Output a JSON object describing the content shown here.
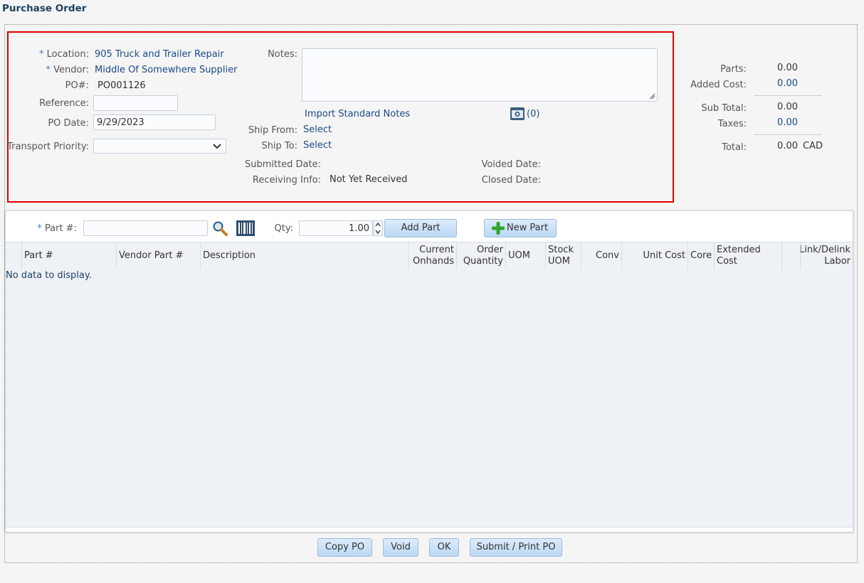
{
  "page": {
    "title": "Purchase Order"
  },
  "header": {
    "location_label": "Location:",
    "location_value": "905 Truck and Trailer Repair",
    "vendor_label": "Vendor:",
    "vendor_value": "Middle Of Somewhere Supplier",
    "po_label": "PO#:",
    "po_value": "PO001126",
    "reference_label": "Reference:",
    "reference_value": "",
    "po_date_label": "PO Date:",
    "po_date_value": "9/29/2023",
    "transport_priority_label": "Transport Priority:",
    "transport_priority_value": "",
    "required_marker": "*"
  },
  "notes": {
    "label": "Notes:",
    "value": "",
    "import_link": "Import Standard Notes",
    "attachment_count": "(0)"
  },
  "shipping": {
    "ship_from_label": "Ship From:",
    "ship_from_value": "Select",
    "ship_to_label": "Ship To:",
    "ship_to_value": "Select",
    "submitted_label": "Submitted Date:",
    "submitted_value": "",
    "voided_label": "Voided Date:",
    "voided_value": "",
    "receiving_label": "Receiving Info:",
    "receiving_value": "Not Yet Received",
    "closed_label": "Closed Date:",
    "closed_value": ""
  },
  "totals": {
    "parts_label": "Parts:",
    "parts_value": "0.00",
    "added_cost_label": "Added Cost:",
    "added_cost_value": "0.00",
    "sub_total_label": "Sub Total:",
    "sub_total_value": "0.00",
    "taxes_label": "Taxes:",
    "taxes_value": "0.00",
    "total_label": "Total:",
    "total_value": "0.00",
    "currency": "CAD"
  },
  "add_part": {
    "part_label": "Part #:",
    "part_value": "",
    "qty_label": "Qty:",
    "qty_value": "1.00",
    "add_button": "Add Part",
    "new_button": "New Part"
  },
  "grid": {
    "columns": [
      {
        "key": "part",
        "label": "Part #"
      },
      {
        "key": "vendor_part",
        "label": "Vendor Part #"
      },
      {
        "key": "description",
        "label": "Description"
      },
      {
        "key": "current_onhands",
        "label": "Current Onhands"
      },
      {
        "key": "order_quantity",
        "label": "Order Quantity"
      },
      {
        "key": "uom",
        "label": "UOM"
      },
      {
        "key": "stock_uom",
        "label": "Stock UOM"
      },
      {
        "key": "conv",
        "label": "Conv"
      },
      {
        "key": "unit_cost",
        "label": "Unit Cost"
      },
      {
        "key": "core",
        "label": "Core"
      },
      {
        "key": "extended_cost",
        "label": "Extended Cost"
      },
      {
        "key": "link_delink",
        "label": "Link/Delink Labor"
      }
    ],
    "empty_text": "No data to display."
  },
  "footer": {
    "copy": "Copy PO",
    "void": "Void",
    "ok": "OK",
    "submit": "Submit / Print PO"
  },
  "colors": {
    "highlight_border": "#e00000",
    "link": "#1a4a8a",
    "button_top": "#dcecfb",
    "button_bottom": "#bcd8f3"
  }
}
